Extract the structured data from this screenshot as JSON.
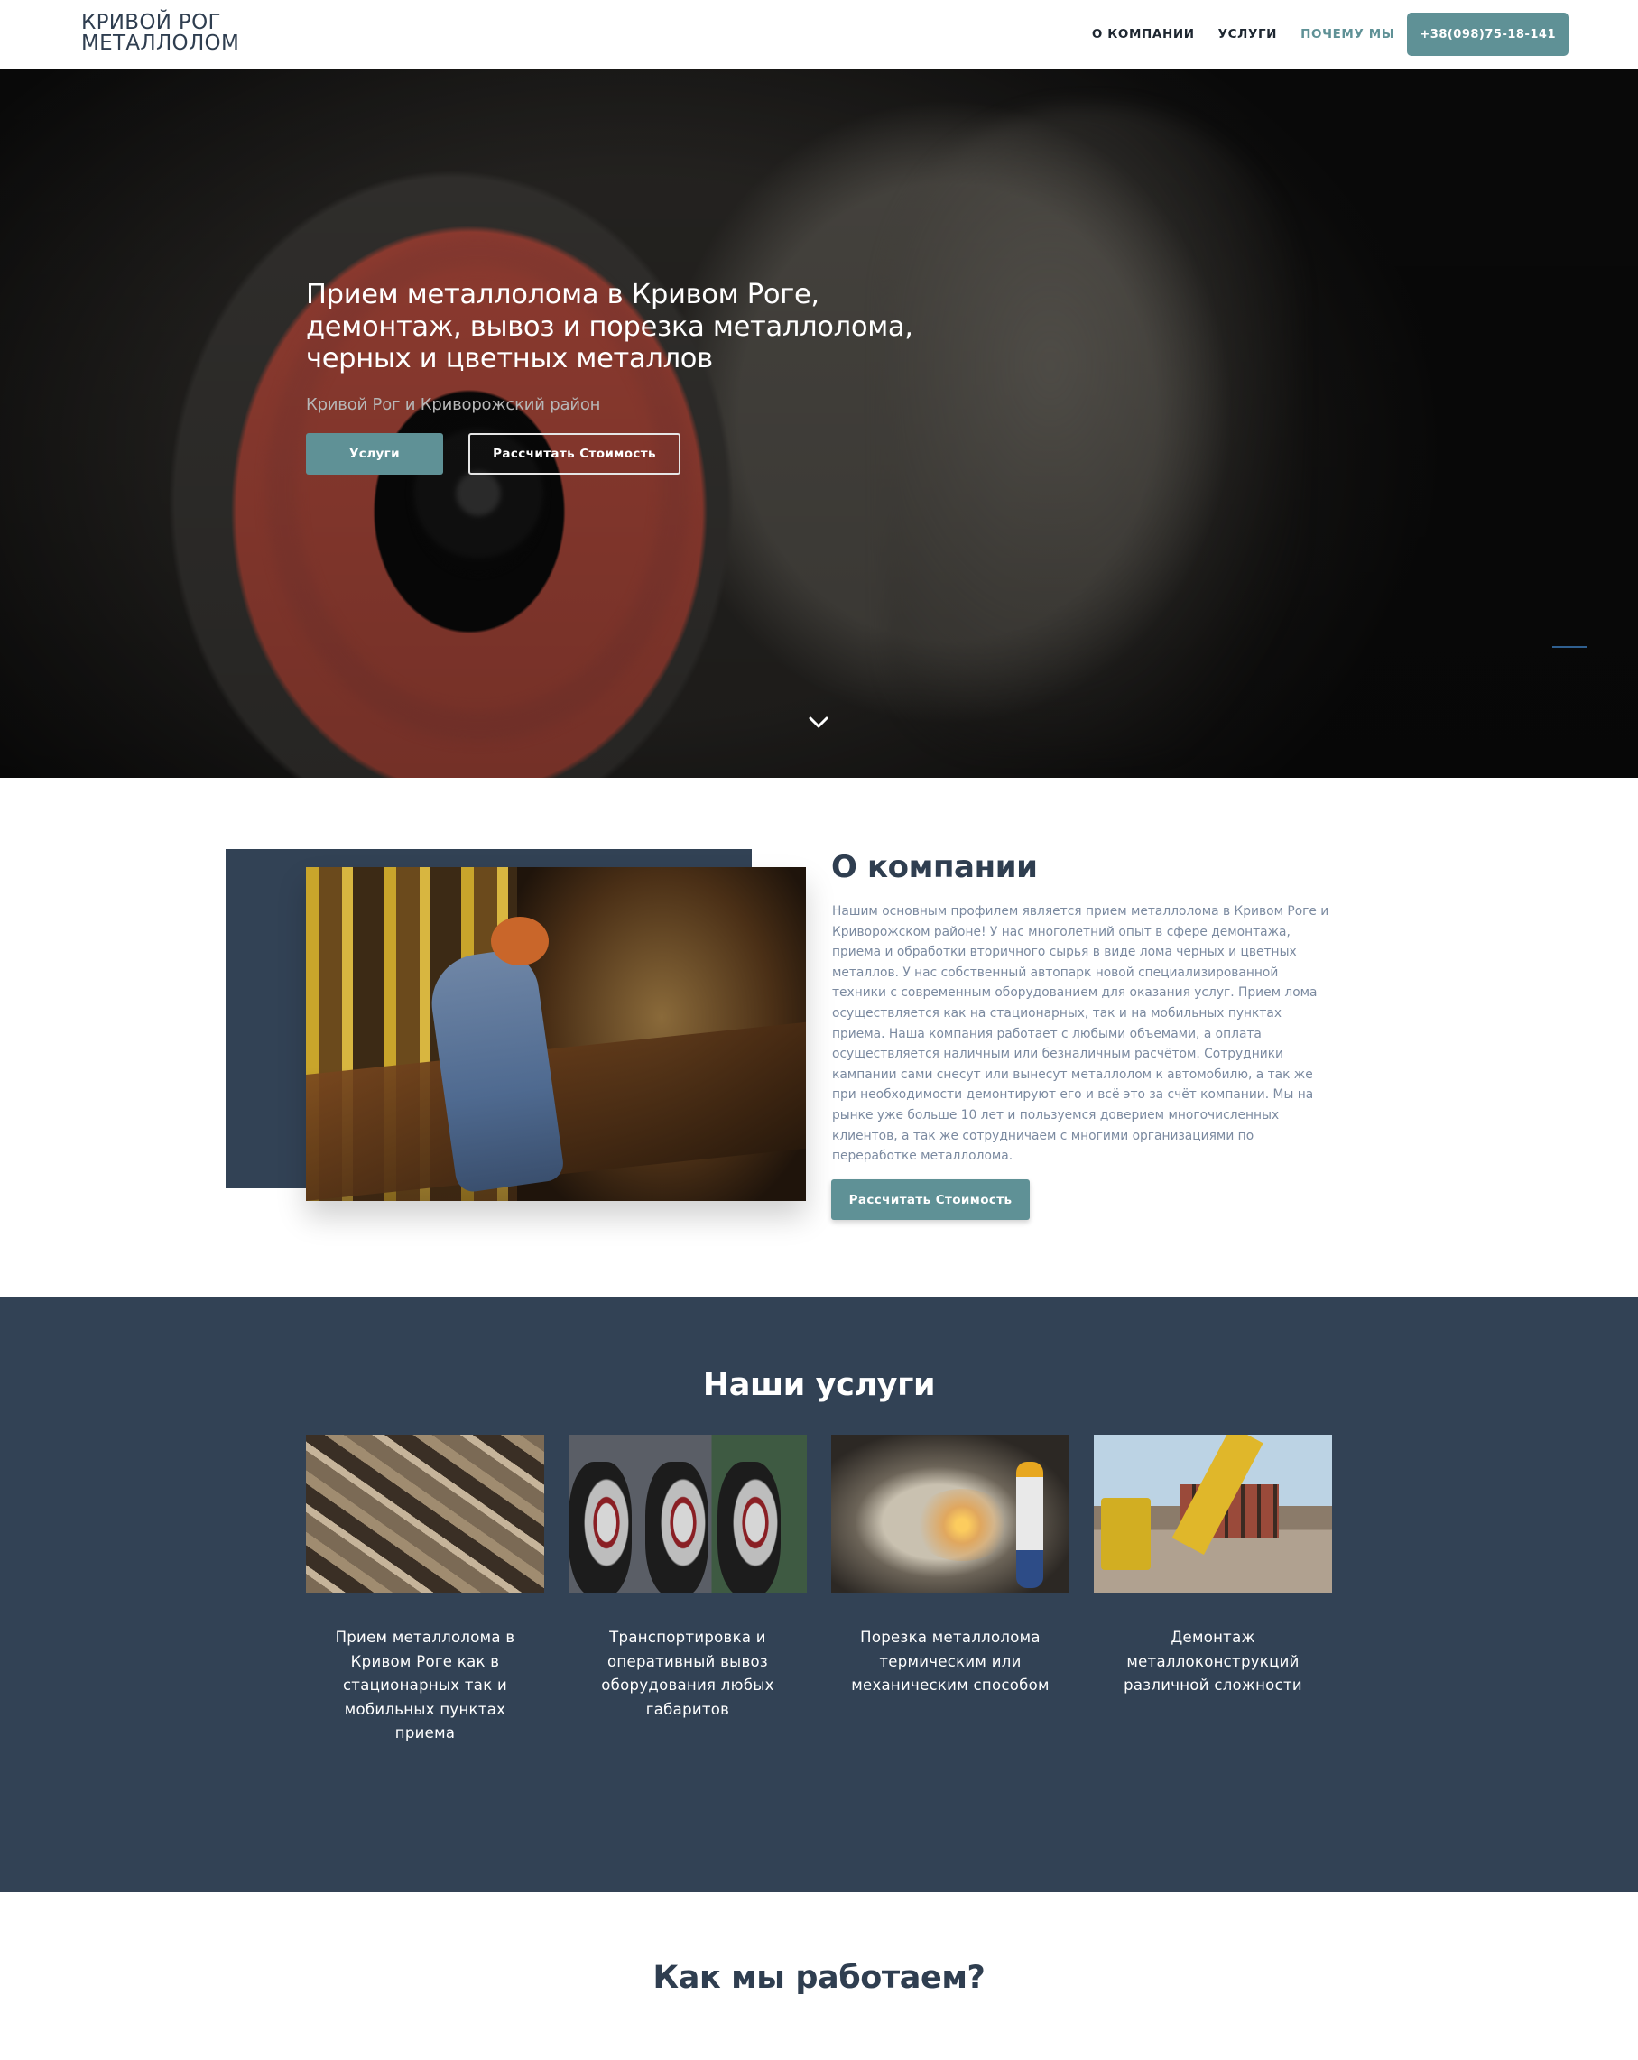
{
  "header": {
    "logo_line1": "КРИВОЙ РОГ",
    "logo_line2": "МЕТАЛЛОЛОМ",
    "nav": [
      {
        "label": "О КОМПАНИИ"
      },
      {
        "label": "УСЛУГИ"
      },
      {
        "label": "ПОЧЕМУ МЫ"
      }
    ],
    "phone": "+38(098)75-18-141"
  },
  "hero": {
    "title": "Прием металлолома в Кривом Роге, демонтаж, вывоз и порезка металлолома, черных и цветных металлов",
    "subtitle": "Кривой Рог и Криворожский район",
    "btn_services": "Услуги",
    "btn_calculate": "Рассчитать Стоимость",
    "scroll_icon": "chevron-down-icon"
  },
  "about": {
    "title": "О компании",
    "text": "Нашим основным профилем является прием металлолома в Кривом Роге и Криворожском районе! У нас многолетний опыт в сфере демонтажа, приема и обработки вторичного сырья в виде лома черных и цветных металлов. У нас собственный автопарк новой специализированной техники с современным оборудованием для оказания услуг. Прием лома осуществляется как на стационарных, так и на мобильных пунктах приема. Наша компания работает с любыми объемами, а оплата осуществляется наличным или безналичным расчётом. Сотрудники кампании сами снесут или вынесут металлолом к автомобилю, а так же при необходимости демонтируют его и всё это за счёт компании. Мы на рынке уже больше 10 лет и пользуемся доверием многочисленных клиентов, а так же сотрудничаем с многими организациями по переработке металлолома.",
    "btn_calculate": "Рассчитать Стоимость"
  },
  "services": {
    "title": "Наши услуги",
    "items": [
      {
        "label": "Прием металлолома в Кривом Роге как в стационарных так и мобильных пунктах приема"
      },
      {
        "label": "Транспортировка и оперативный вывоз оборудования любых габаритов"
      },
      {
        "label": "Порезка металлолома термическим или механическим способом"
      },
      {
        "label": "Демонтаж металлоконструкций различной сложности"
      }
    ]
  },
  "how": {
    "title": "Как мы работаем?"
  },
  "colors": {
    "accent": "#5f9196",
    "dark": "#324255",
    "text": "#2f3e50",
    "muted": "#7b8aa0"
  }
}
